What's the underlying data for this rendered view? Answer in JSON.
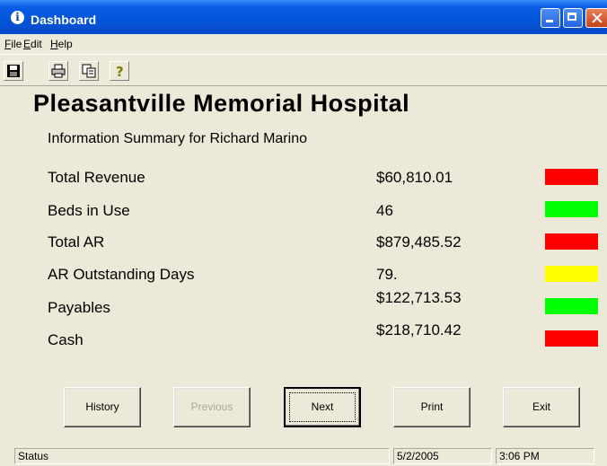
{
  "window": {
    "title": "Dashboard",
    "icon": "info-icon"
  },
  "menu": [
    "File",
    "Edit",
    "Help"
  ],
  "toolbar": [
    "save-icon",
    "print-icon",
    "copy-icon",
    "help-icon"
  ],
  "header": {
    "hospital": "Pleasantville Memorial Hospital",
    "subtitle": "Information Summary for Richard Marino"
  },
  "metrics": [
    {
      "label": "Total Revenue",
      "value": "$60,810.01",
      "status_color": "#ff0000"
    },
    {
      "label": "Beds in Use",
      "value": "46",
      "status_color": "#00ff00"
    },
    {
      "label": "Total AR",
      "value": "$879,485.52",
      "status_color": "#ff0000"
    },
    {
      "label": "AR Outstanding Days",
      "value": "79.",
      "status_color": "#ffff00"
    },
    {
      "label": "Payables",
      "value": "$122,713.53",
      "status_color": "#00ff00"
    },
    {
      "label": "Cash",
      "value": "$218,710.42",
      "status_color": "#ff0000"
    }
  ],
  "buttons": {
    "history": "History",
    "previous": "Previous",
    "next": "Next",
    "print": "Print",
    "exit": "Exit"
  },
  "status": {
    "text": "Status",
    "date": "5/2/2005",
    "time": "3:06 PM"
  }
}
